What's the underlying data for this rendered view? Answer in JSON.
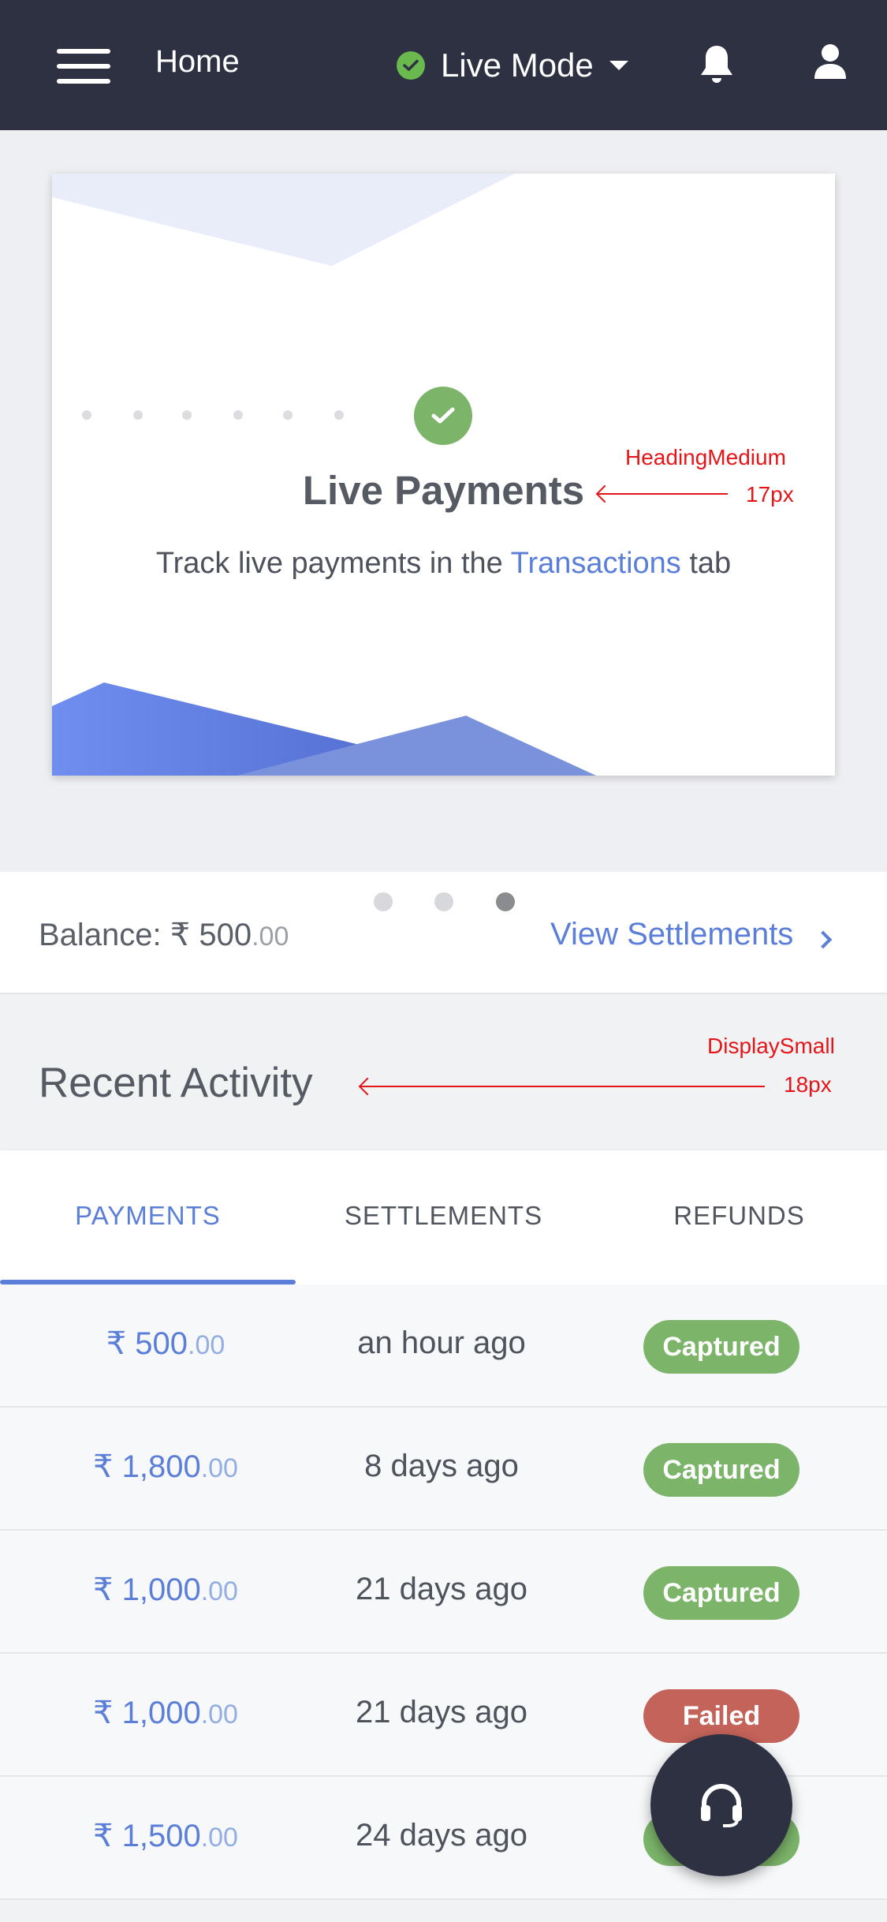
{
  "header": {
    "title": "Home",
    "mode_label": "Live Mode",
    "icons": [
      "hamburger-icon",
      "check-icon",
      "chevron-down-icon",
      "bell-icon",
      "user-icon"
    ]
  },
  "card": {
    "heading": "Live Payments",
    "text_before": "Track live payments in the ",
    "link_text": "Transactions",
    "text_after": " tab"
  },
  "annotations": {
    "heading": {
      "name": "HeadingMedium",
      "size": "17px"
    },
    "recent": {
      "name": "DisplaySmall",
      "size": "18px"
    }
  },
  "carousel": {
    "count": 3,
    "active_index": 2
  },
  "balance": {
    "label": "Balance: ",
    "currency": "₹",
    "amount": " 500",
    "decimals": ".00"
  },
  "settlements_link": "View Settlements",
  "recent_activity": {
    "title": "Recent Activity"
  },
  "tabs": [
    {
      "label": "PAYMENTS",
      "active": true
    },
    {
      "label": "SETTLEMENTS",
      "active": false
    },
    {
      "label": "REFUNDS",
      "active": false
    }
  ],
  "payments": [
    {
      "amount": "₹ 500",
      "decimals": ".00",
      "time": "an hour ago",
      "status": "Captured"
    },
    {
      "amount": "₹ 1,800",
      "decimals": ".00",
      "time": "8 days ago",
      "status": "Captured"
    },
    {
      "amount": "₹ 1,000",
      "decimals": ".00",
      "time": "21 days ago",
      "status": "Captured"
    },
    {
      "amount": "₹ 1,000",
      "decimals": ".00",
      "time": "21 days ago",
      "status": "Failed"
    },
    {
      "amount": "₹ 1,500",
      "decimals": ".00",
      "time": "24 days ago",
      "status": "Captured"
    }
  ],
  "colors": {
    "header_bg": "#2e3141",
    "accent": "#5b7ed8",
    "success": "#7cb46a",
    "failed": "#c4635a",
    "annotation": "#e4161a"
  },
  "support_fab_icon": "headset-icon"
}
